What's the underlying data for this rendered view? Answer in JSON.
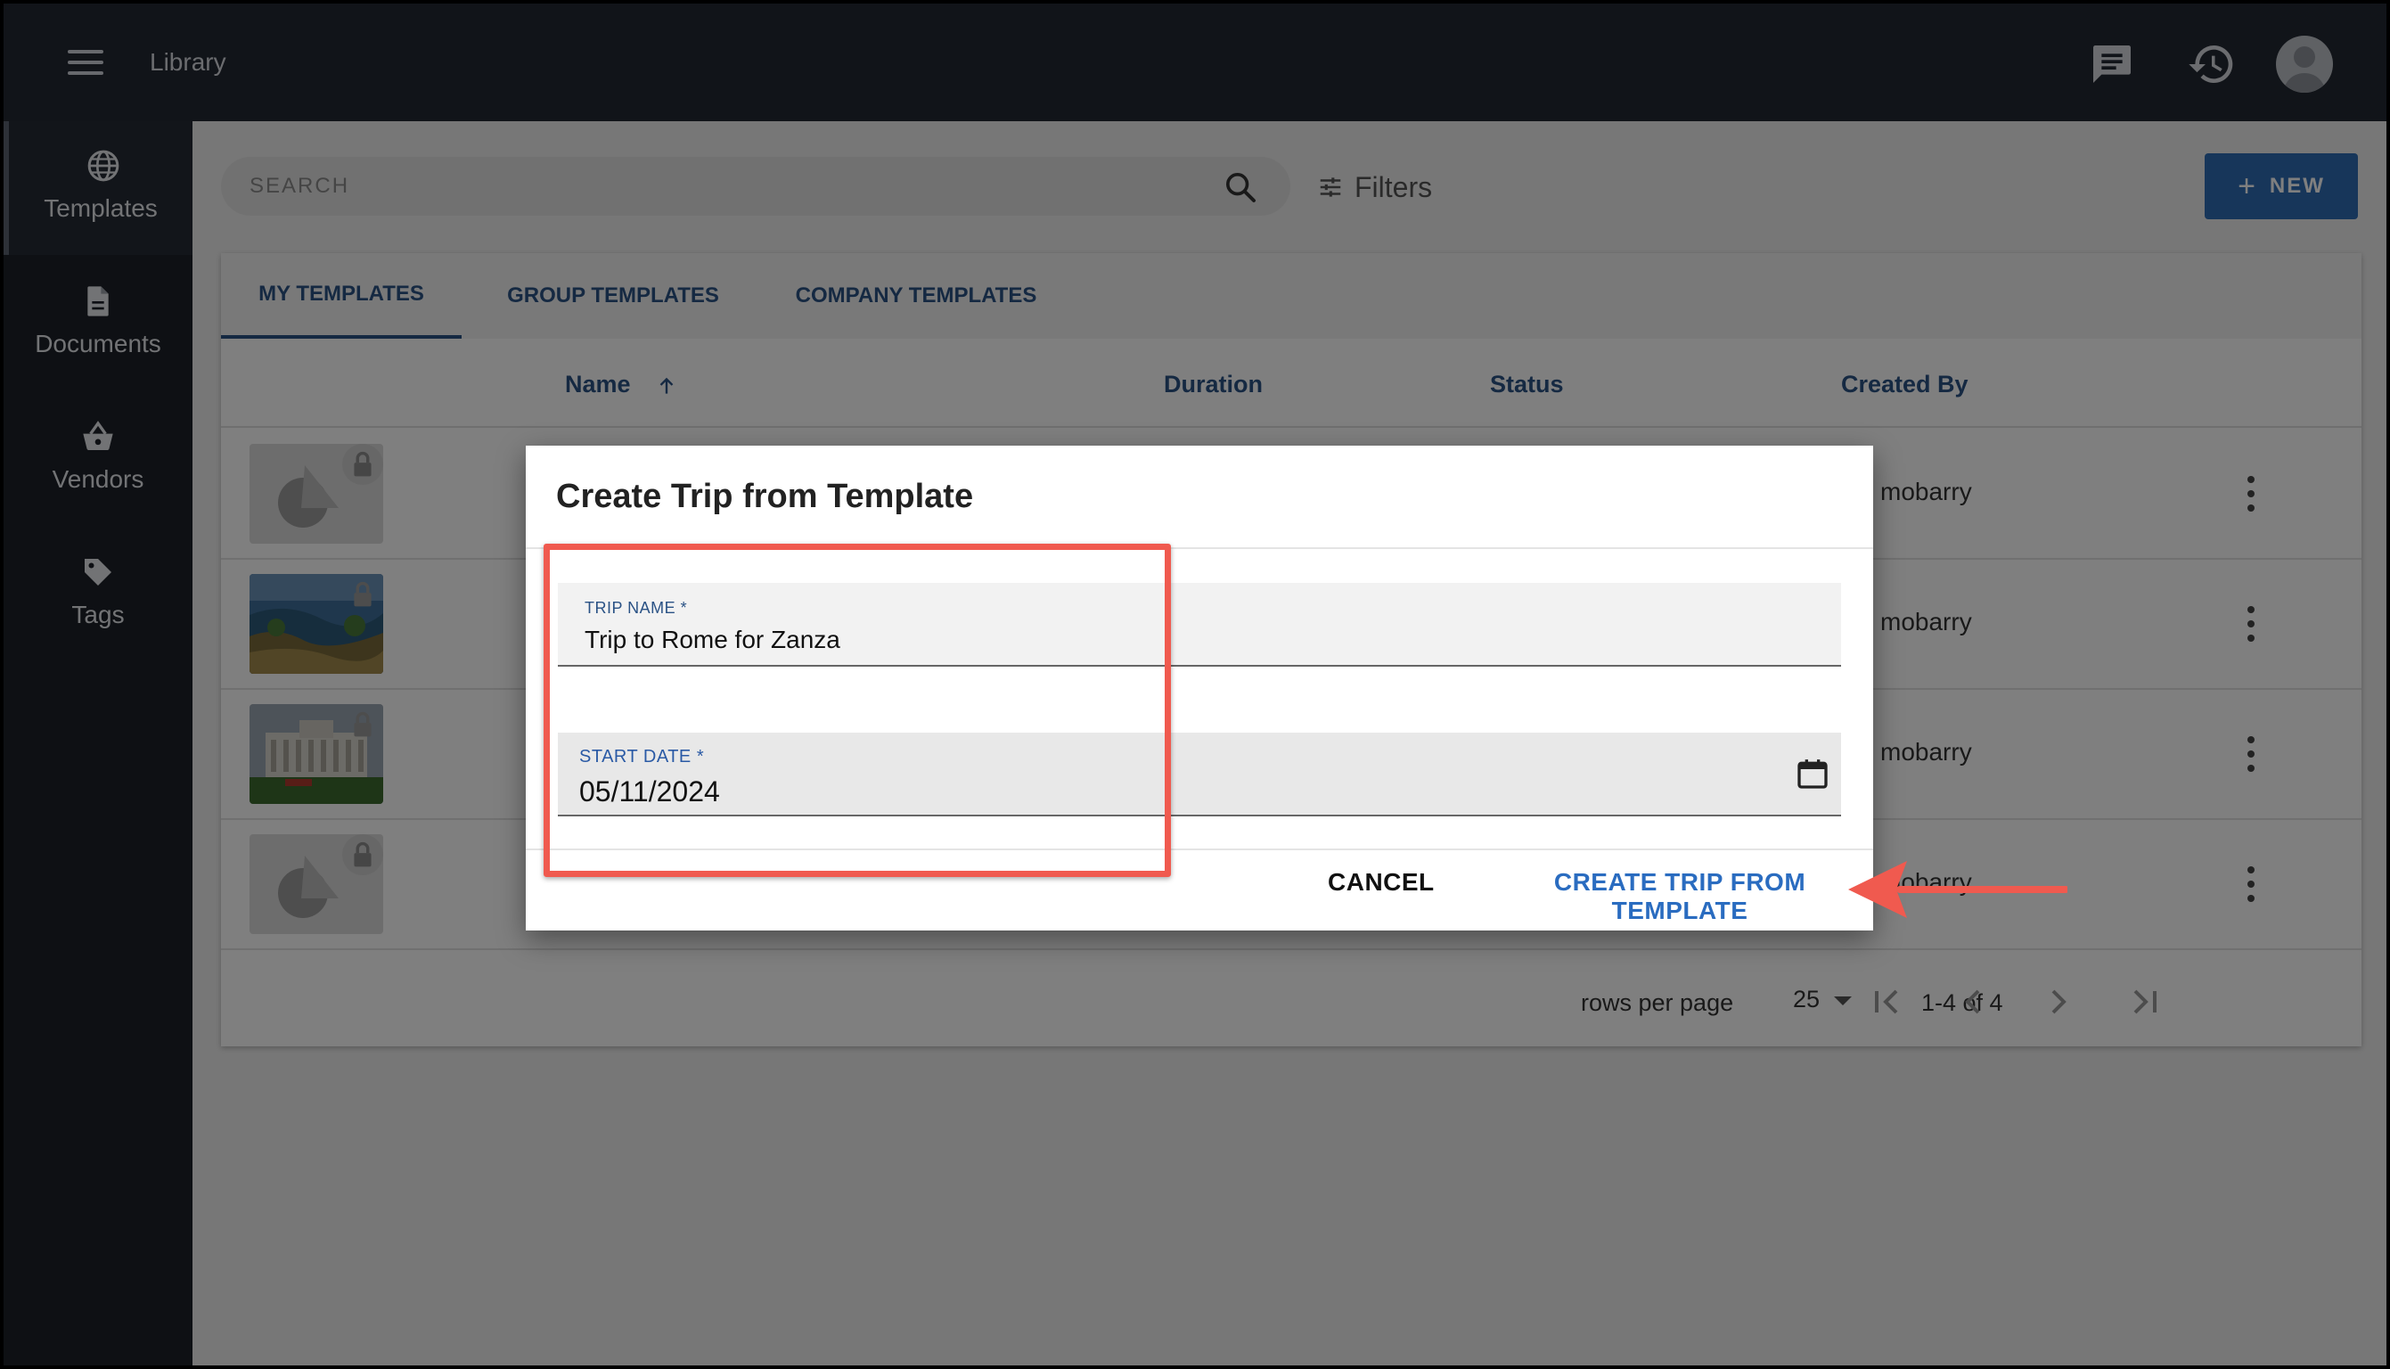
{
  "header": {
    "title": "Library"
  },
  "sidebar": {
    "items": [
      {
        "label": "Templates",
        "icon": "globe-icon",
        "active": true
      },
      {
        "label": "Documents",
        "icon": "document-icon"
      },
      {
        "label": "Vendors",
        "icon": "basket-icon"
      },
      {
        "label": "Tags",
        "icon": "tag-icon"
      }
    ]
  },
  "toolbar": {
    "search_placeholder": "SEARCH",
    "filters_label": "Filters",
    "new_label": "NEW"
  },
  "tabs": [
    {
      "label": "MY TEMPLATES",
      "active": true
    },
    {
      "label": "GROUP TEMPLATES"
    },
    {
      "label": "COMPANY TEMPLATES"
    }
  ],
  "table": {
    "columns": [
      "Name",
      "Duration",
      "Status",
      "Created By"
    ],
    "rows": [
      {
        "created_by": "mobarry",
        "thumb": "placeholder"
      },
      {
        "created_by": "mobarry",
        "thumb": "coast-photo"
      },
      {
        "created_by": "mobarry",
        "thumb": "monument-photo"
      },
      {
        "created_by": "mobarry",
        "thumb": "placeholder"
      }
    ]
  },
  "pagination": {
    "rows_per_page_label": "rows per page",
    "rows_per_page": "25",
    "range": "1-4 of 4"
  },
  "dialog": {
    "title": "Create Trip from Template",
    "trip_name_label": "TRIP NAME *",
    "trip_name_value": "Trip to Rome for Zanza",
    "start_date_label": "START DATE *",
    "start_date_value": "05/11/2024",
    "cancel_label": "CANCEL",
    "create_label": "CREATE TRIP FROM TEMPLATE"
  },
  "colors": {
    "accent": "#2a5285",
    "primary_button": "#2f6db5",
    "annotation": "#f05a4f"
  }
}
